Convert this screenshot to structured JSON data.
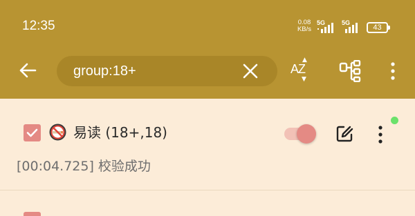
{
  "status_bar": {
    "time": "12:35",
    "net_speed_value": "0.08",
    "net_speed_unit": "KB/s",
    "sim1_label": "5G",
    "sim2_label": "5G",
    "battery_level": "43"
  },
  "toolbar": {
    "search_value": "group:18+",
    "sort_icon": "sort-az-icon",
    "group_icon": "group-icon"
  },
  "source_list": {
    "items": [
      {
        "checked": true,
        "name": "易读 (18+,18)",
        "enabled": true,
        "check_result": "[00:04.725] 校验成功",
        "status_color": "#6be16b"
      }
    ]
  },
  "colors": {
    "app_bar": "#b89432",
    "background": "#fcecd8",
    "accent": "#e48a84"
  }
}
